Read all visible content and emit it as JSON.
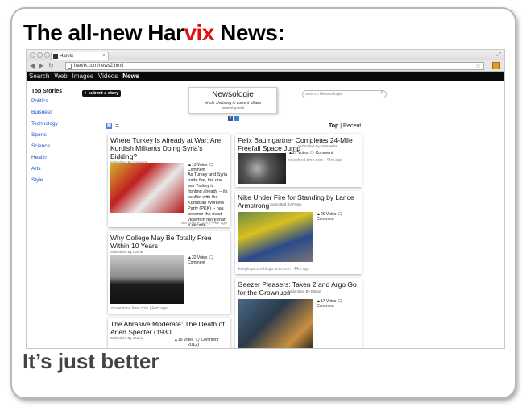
{
  "slide": {
    "title_prefix": "The all-new ",
    "title_brand_a": "Har",
    "title_brand_b": "vix",
    "title_suffix": " News:",
    "tagline": "It’s just better"
  },
  "browser": {
    "tab_title": "Harvix",
    "url": "harvix.com/news2.html",
    "nav": [
      "Search",
      "Web",
      "Images",
      "Videos",
      "News"
    ],
    "active_nav": "News"
  },
  "site": {
    "sidebar_heading": "Top Stories",
    "categories": [
      "Politics",
      "Buisness",
      "Technology",
      "Sports",
      "Science",
      "Health",
      "Arts",
      "Style"
    ],
    "submit_label": "+ submit a story",
    "logo_name": "Newsologie",
    "logo_tagline": "whole shebang in current affairs",
    "logo_powered": "powered by rockd",
    "search_placeholder": "search Newsologie",
    "sort_top": "Top",
    "sort_sep": " | ",
    "sort_recent": "Recent"
  },
  "stories": {
    "left": [
      {
        "title": "Where Turkey Is Already at War: Are Kurdish Militants Doing Syria's Bidding?",
        "submitted_by": "Submitted By Cameron",
        "votes": "▲13 Votes",
        "comment": "Comment",
        "excerpt": "As Turkey and Syria trade fire, the one war Turkey is fighting already -- its conflict with the Kurdistan Workers' Party (PKK) -- has become the most violent in more than a decade.",
        "source": "world.time.com",
        "age": "44m ago"
      },
      {
        "title": "Why College May Be Totally Free Within 10 Years",
        "submitted_by": "Submitted By Carrie",
        "votes": "▲32 Votes",
        "comment": "Comment",
        "source": "moneyland.time.com",
        "age": "44m ago"
      },
      {
        "title": "The Abrasive Moderate: The Death of Arlen Specter (1930",
        "submitted_by": "Submitted By Jeanie",
        "votes": "▲15 Votes",
        "comment": "Comment",
        "excerpt_tail": "2012)"
      }
    ],
    "right": [
      {
        "title": "Felix Baumgartner Completes 24-Mile Freefall Space Jump",
        "submitted_by": "Submitted By Samantha",
        "votes": "▲27 Votes",
        "comment": "Comment",
        "source": "newsfeed.time.com",
        "age": "44m ago"
      },
      {
        "title": "Nike Under Fire for Standing by Lance Armstrong",
        "submitted_by": "Submitted By Frank",
        "votes": "▲20 Votes",
        "comment": "Comment",
        "source": "keepingscore.blogs.time.com",
        "age": "44m ago"
      },
      {
        "title": "Geezer Pleasers: Taken 2 and Argo Go for the Grownups",
        "submitted_by": "Submitted By Elaine",
        "votes": "▲17 Votes",
        "comment": "Comment"
      }
    ]
  },
  "colors": {
    "brand_red": "#e01010",
    "link_blue": "#1a4fd6",
    "nav_black": "#0a0a0a"
  }
}
